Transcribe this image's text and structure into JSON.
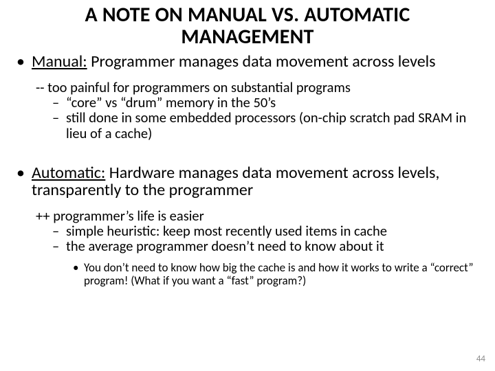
{
  "title": "A NOTE ON MANUAL VS. AUTOMATIC MANAGEMENT",
  "manual": {
    "label": "Manual:",
    "text": " Programmer manages data movement across levels",
    "note": "-- too painful for programmers on substantial programs",
    "sub": [
      "“core” vs “drum” memory in the 50’s",
      "still done in some embedded processors (on-chip scratch pad SRAM in lieu of a cache)"
    ]
  },
  "automatic": {
    "label": "Automatic:",
    "text": " Hardware manages data movement across levels, transparently to the programmer",
    "note": "++ programmer’s life is easier",
    "sub": [
      "simple heuristic: keep most recently used items in cache",
      "the average programmer doesn’t need to know about it"
    ],
    "subsub": "You don’t need to know how big the cache is and how it works to write a “correct” program! (What if you want a “fast” program?)"
  },
  "page_number": "44"
}
